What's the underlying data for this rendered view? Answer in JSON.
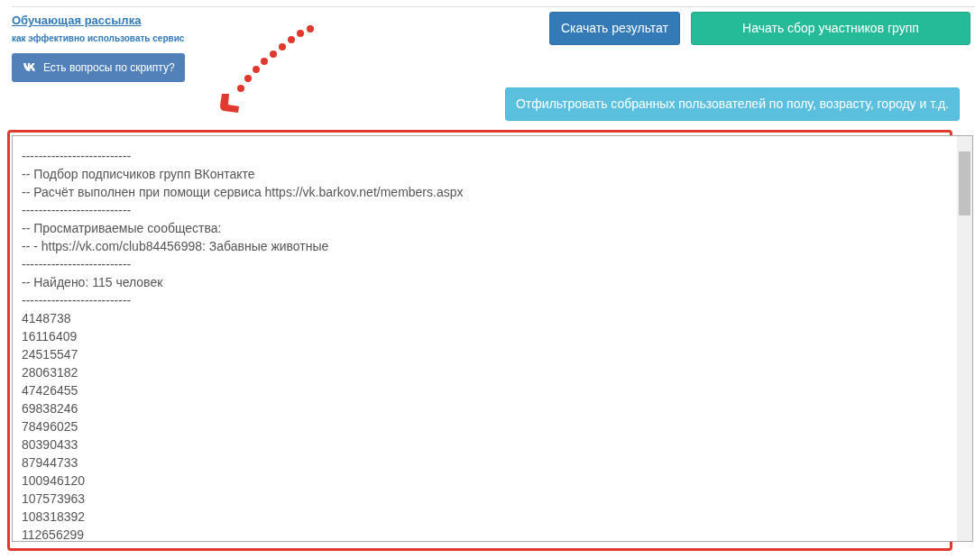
{
  "newsletter_link": "Обучающая рассылка",
  "newsletter_subtitle": "как эффективно использовать сервис",
  "vk_button": "Есть вопросы по скрипту?",
  "download_button": "Скачать результат",
  "start_button": "Начать сбор участников групп",
  "filter_button": "Отфильтровать собранных пользователей по полу, возрасту, городу и т.д.",
  "result_lines": [
    "--------------------------",
    "-- Подбор подписчиков групп ВКонтакте",
    "-- Расчёт выполнен при помощи сервиса https://vk.barkov.net/members.aspx",
    "--------------------------",
    "-- Просматриваемые сообщества:",
    "-- - https://vk.com/club84456998: Забавные животные",
    "--------------------------",
    "-- Найдено: 115 человек",
    "--------------------------",
    "4148738",
    "16116409",
    "24515547",
    "28063182",
    "47426455",
    "69838246",
    "78496025",
    "80390433",
    "87944733",
    "100946120",
    "107573963",
    "108318392",
    "112656299"
  ]
}
